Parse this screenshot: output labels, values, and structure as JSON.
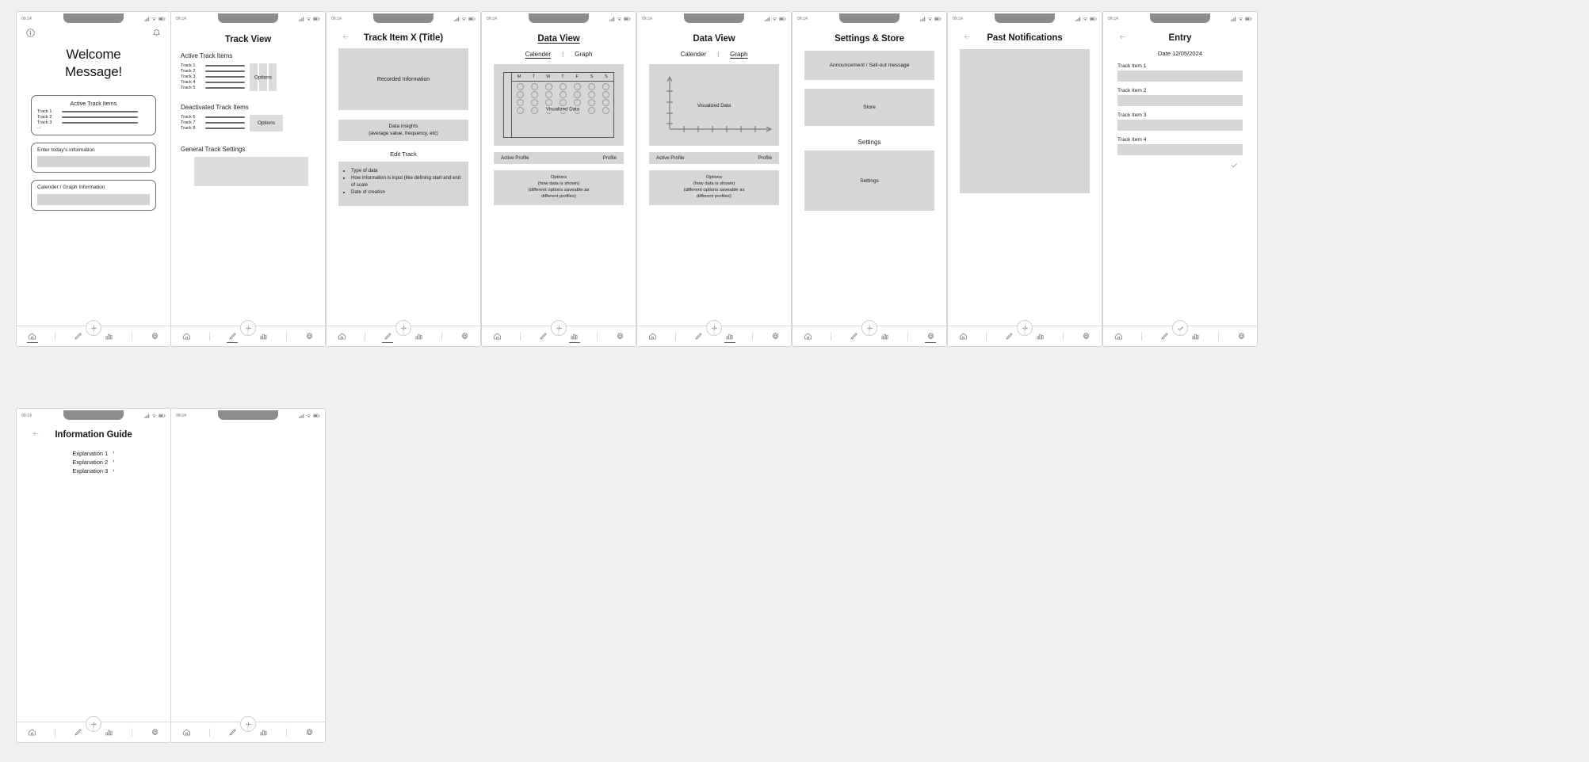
{
  "meta": {
    "status_time": "09:14",
    "icons": {
      "signal": "cellular-signal-icon",
      "wifi": "wifi-icon",
      "battery": "battery-icon",
      "info": "info-icon",
      "bell": "bell-icon",
      "back": "back-arrow-icon",
      "home": "home-icon",
      "pencil": "pencil-icon",
      "plus": "plus-icon",
      "chart": "bar-chart-icon",
      "gear": "gear-icon",
      "check": "check-icon",
      "chevron": "chevron-right-icon"
    }
  },
  "nav": {
    "home_label": "Home",
    "edit_label": "Edit",
    "add_label": "Add",
    "data_label": "Data",
    "settings_label": "Settings"
  },
  "screens": {
    "welcome": {
      "title": "Welcome\nMessage!",
      "title_line1": "Welcome",
      "title_line2": "Message!",
      "card_active": {
        "title": "Active Track Items",
        "tracks": [
          "Track 1",
          "Track 2",
          "Track 3"
        ],
        "ellipsis": "..."
      },
      "card_entry": {
        "label": "Enter today's information"
      },
      "card_calendar": {
        "label": "Calender / Graph Information"
      }
    },
    "track_view": {
      "title": "Track View",
      "active_heading": "Active Track Items",
      "active_tracks": [
        "Track 1",
        "Track 2",
        "Track 3",
        "Track 4",
        "Track 5"
      ],
      "active_options_label": "Options",
      "deactivated_heading": "Deactivated Track Items",
      "deactivated_tracks": [
        "Track 6",
        "Track 7",
        "Track 8"
      ],
      "deactivated_options_label": "Options",
      "general_settings_heading": "General Track Settings"
    },
    "track_item": {
      "title": "Track Item X (Title)",
      "recorded_label": "Recorded Information",
      "insights_line1": "Data insights",
      "insights_line2": "(average value, frequency, etc)",
      "edit_heading": "Edit Track",
      "edit_bullets": [
        "Type of data",
        "How information is input (like defining start and end of scale",
        "Date of creation"
      ]
    },
    "data_view_calendar": {
      "title": "Data View",
      "tab_calendar": "Calender",
      "tab_separator": "|",
      "tab_graph": "Graph",
      "active_tab": "Calender",
      "weekdays": [
        "M",
        "T",
        "W",
        "T",
        "F",
        "S",
        "S"
      ],
      "viz_label": "Visualized Data",
      "profile_left": "Active Profile",
      "profile_right": "Profile",
      "options_line1": "Options",
      "options_line2": "(how data is shown)",
      "options_line3": "(different options saveable as",
      "options_line4": "different profiles)"
    },
    "data_view_graph": {
      "title": "Data View",
      "tab_calendar": "Calender",
      "tab_separator": "|",
      "tab_graph": "Graph",
      "active_tab": "Graph",
      "viz_label": "Visualized Data",
      "profile_left": "Active Profile",
      "profile_right": "Profile",
      "options_line1": "Options",
      "options_line2": "(how data is shown)",
      "options_line3": "(different options saveable as",
      "options_line4": "different profiles)"
    },
    "settings_store": {
      "title": "Settings & Store",
      "announcement_label": "Announcement / Sell-out message",
      "store_label": "Store",
      "settings_heading": "Settings",
      "settings_label": "Settings"
    },
    "past_notifications": {
      "title": "Past Notifications"
    },
    "entry": {
      "title": "Entry",
      "date_label": "Date 12/05/2024",
      "items": [
        "Track Item 1",
        "Track Item 2",
        "Track Item 3",
        "Track Item 4"
      ],
      "confirm_label": "Confirm"
    },
    "information_guide": {
      "title": "Information Guide",
      "explanations": [
        "Explanation 1",
        "Explanation 2",
        "Explanation 3"
      ],
      "chevron": "›"
    },
    "blank": {
      "title": ""
    }
  },
  "colors": {
    "canvas_bg": "#f0f0f0",
    "phone_bg": "#ffffff",
    "grey_fill": "#d6d6d6",
    "notch": "#8c8c8c",
    "text": "#1c1c1c",
    "muted": "#9a9a9a"
  }
}
